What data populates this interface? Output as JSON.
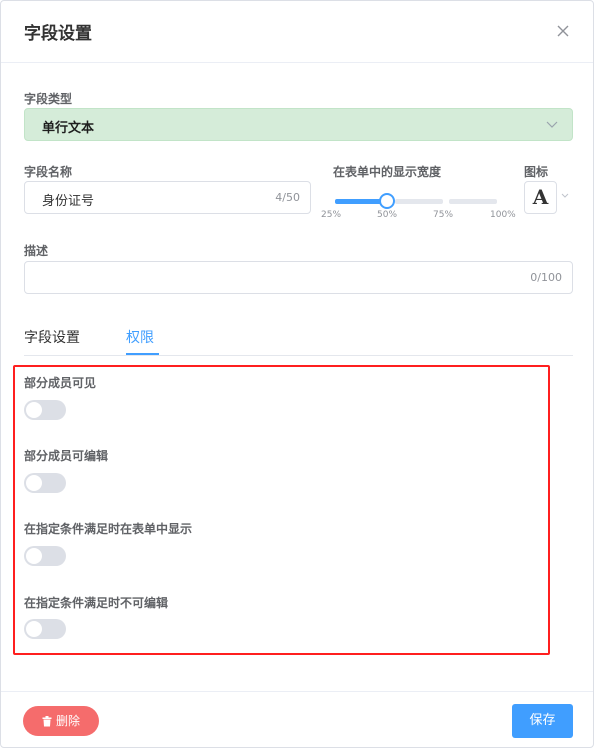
{
  "dialog": {
    "title": "字段设置"
  },
  "field_type": {
    "label": "字段类型",
    "value": "单行文本"
  },
  "field_name": {
    "label": "字段名称",
    "value": "身份证号",
    "counter": "4/50"
  },
  "display_width": {
    "label": "在表单中的显示宽度",
    "ticks": [
      "25%",
      "50%",
      "75%",
      "100%"
    ],
    "selected": "50%"
  },
  "icon": {
    "label": "图标",
    "glyph": "A"
  },
  "description": {
    "label": "描述",
    "value": "",
    "counter": "0/100"
  },
  "tabs": [
    {
      "label": "字段设置",
      "active": false
    },
    {
      "label": "权限",
      "active": true
    }
  ],
  "permissions": [
    {
      "label": "部分成员可见",
      "enabled": false
    },
    {
      "label": "部分成员可编辑",
      "enabled": false
    },
    {
      "label": "在指定条件满足时在表单中显示",
      "enabled": false
    },
    {
      "label": "在指定条件满足时不可编辑",
      "enabled": false
    }
  ],
  "footer": {
    "delete_label": "删除",
    "save_label": "保存"
  },
  "colors": {
    "accent": "#409eff",
    "danger": "#f56c6c",
    "highlight_frame": "#ff1f1f",
    "select_bg": "#d5ecd9"
  }
}
